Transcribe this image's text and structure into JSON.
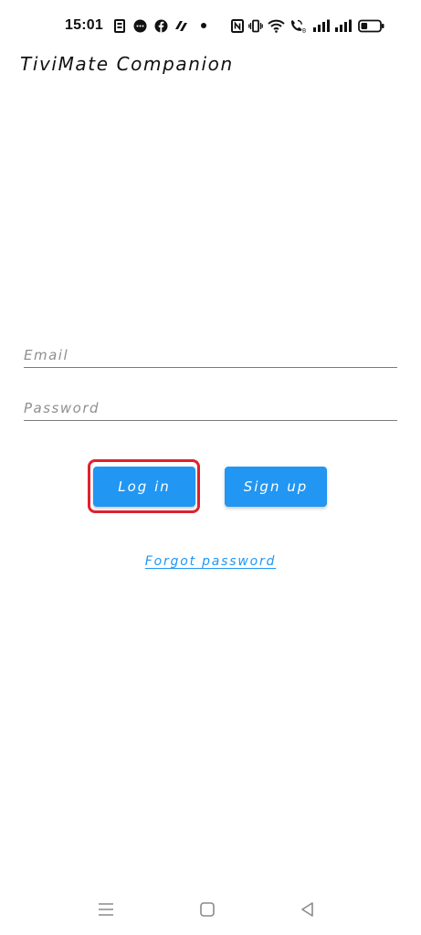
{
  "status_bar": {
    "time": "15:01",
    "battery_level": 0.35,
    "icons": {
      "left": [
        "news-notification-icon",
        "messenger-notification-icon",
        "facebook-notification-icon",
        "app-notification-icon",
        "more-notifications-dot-icon"
      ],
      "right": [
        "nfc-icon",
        "vibrate-icon",
        "wifi-icon",
        "wifi-calling-icon",
        "signal-1-icon",
        "signal-2-icon",
        "battery-icon"
      ]
    }
  },
  "app": {
    "title": "TiviMate Companion"
  },
  "form": {
    "email_placeholder": "Email",
    "email_value": "",
    "password_placeholder": "Password",
    "password_value": ""
  },
  "buttons": {
    "login_label": "Log in",
    "signup_label": "Sign up",
    "forgot_password_label": "Forgot password"
  },
  "nav_bar": {
    "icons": [
      "menu-icon",
      "home-icon",
      "back-icon"
    ]
  },
  "colors": {
    "accent": "#2196f3",
    "highlight": "#e0212e",
    "underline": "#7a7a7a",
    "background": "#ffffff"
  }
}
